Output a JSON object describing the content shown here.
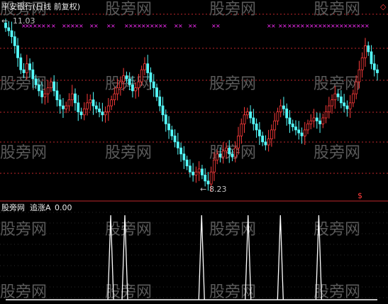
{
  "main_panel": {
    "title": "平安银行(日线 前复权)",
    "high_label": "11.03",
    "low_label": "8.23",
    "arrow": "←",
    "watermark": "股旁网",
    "marker_dollar": "$",
    "marker_diamond": "◇"
  },
  "sub_panel": {
    "watermark_prefix": "股旁网",
    "indicator_name": "追涨A",
    "indicator_value": "0.00"
  },
  "colors": {
    "up": "#ff3b3b",
    "down": "#54fcfc",
    "grid": "#c0292b",
    "text": "#c0c0c0",
    "title": "#e8e8e8",
    "magenta": "#ff30ff",
    "signal": "#ffffff",
    "watermark": "#5a5a5a",
    "separator": "#c0292b"
  },
  "chart_data": [
    {
      "type": "candlestick",
      "title": "平安银行(日线 前复权)",
      "annotations": [
        "11.03",
        "8.23"
      ],
      "high": 11.03,
      "low": 8.23,
      "series": [
        {
          "name": "close",
          "values": [
            10.9,
            10.85,
            10.75,
            10.6,
            10.4,
            10.2,
            10.15,
            10.3,
            10.2,
            10.05,
            9.95,
            9.85,
            9.75,
            9.8,
            9.9,
            10.0,
            9.85,
            9.7,
            9.6,
            9.55,
            9.6,
            9.7,
            9.8,
            9.65,
            9.5,
            9.45,
            9.55,
            9.65,
            9.7,
            9.6,
            9.55,
            9.5,
            9.45,
            9.5,
            9.6,
            9.7,
            9.8,
            9.9,
            10.0,
            10.1,
            10.05,
            9.95,
            9.85,
            9.9,
            10.0,
            10.2,
            10.3,
            10.15,
            10.0,
            9.9,
            9.75,
            9.6,
            9.45,
            9.3,
            9.2,
            9.1,
            9.0,
            8.9,
            8.8,
            8.7,
            8.6,
            8.5,
            8.45,
            8.5,
            8.55,
            8.45,
            8.35,
            8.3,
            8.5,
            8.7,
            8.8,
            8.75,
            8.85,
            8.9,
            8.8,
            8.75,
            8.9,
            9.1,
            9.3,
            9.45,
            9.5,
            9.4,
            9.3,
            9.2,
            9.1,
            9.0,
            8.95,
            9.05,
            9.2,
            9.35,
            9.5,
            9.6,
            9.55,
            9.4,
            9.3,
            9.25,
            9.2,
            9.15,
            9.1,
            9.2,
            9.3,
            9.35,
            9.4,
            9.35,
            9.3,
            9.4,
            9.5,
            9.6,
            9.7,
            9.8,
            9.75,
            9.65,
            9.6,
            9.55,
            9.65,
            9.8,
            10.0,
            10.2,
            10.4,
            10.6,
            10.5,
            10.3,
            10.2,
            10.15
          ]
        }
      ]
    },
    {
      "type": "line",
      "name": "追涨A",
      "value": 0.0,
      "spikes_at_index": [
        52,
        59,
        97,
        120,
        136,
        155
      ],
      "spike_value": 1,
      "baseline": 0
    }
  ]
}
